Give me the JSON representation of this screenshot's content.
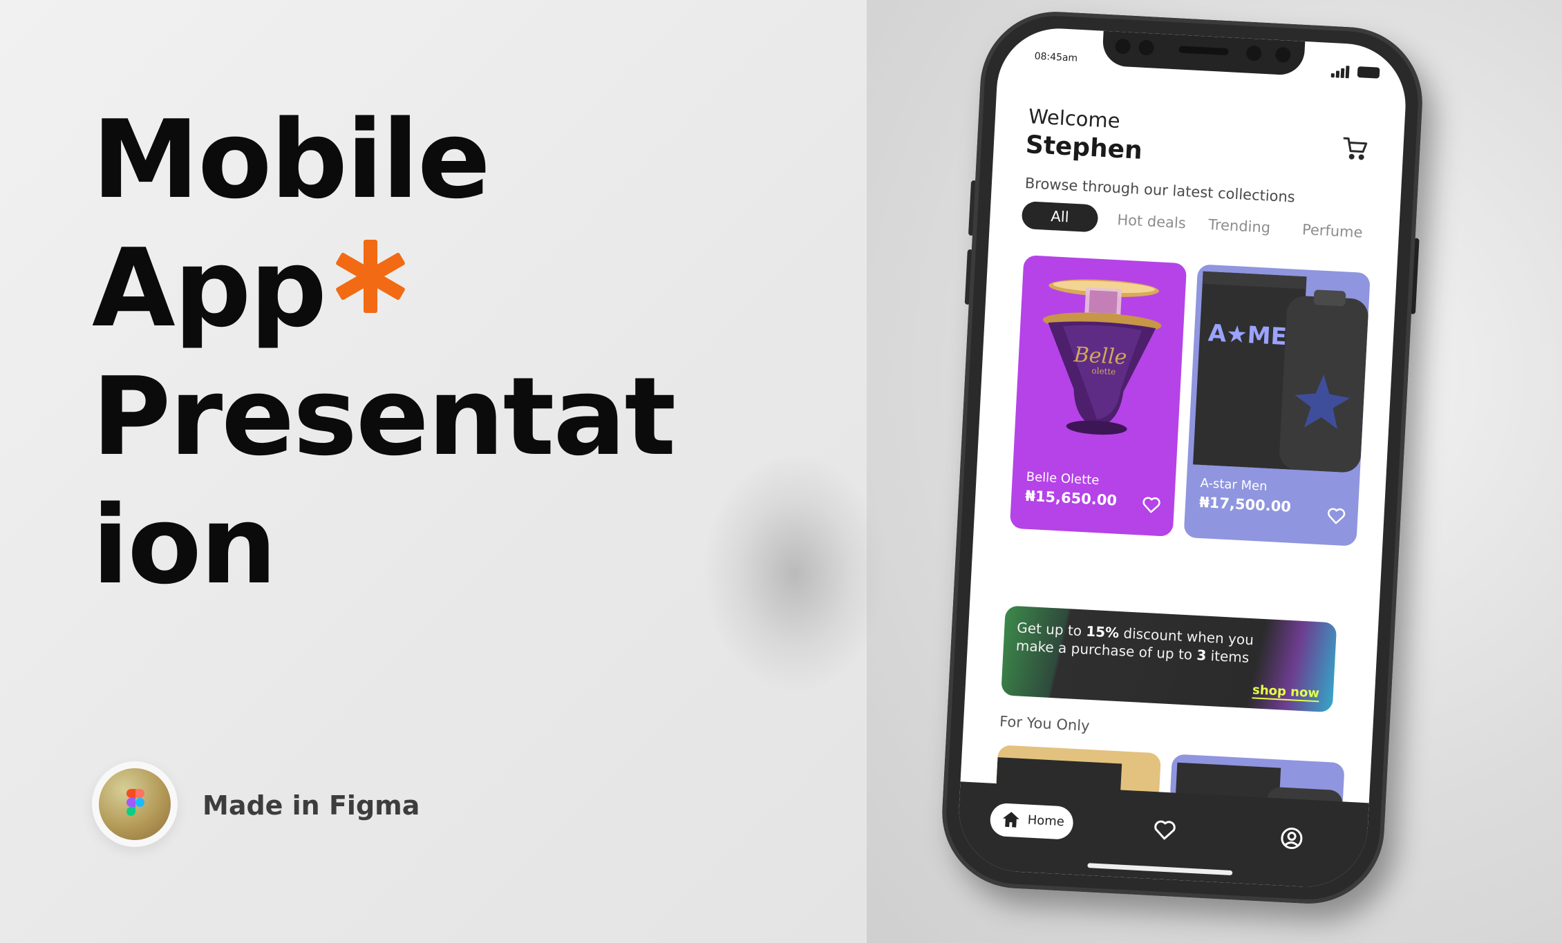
{
  "hero": {
    "title_line1": "Mobile",
    "title_line2": "App",
    "title_line3": "Presentat",
    "title_line4": "ion",
    "accent_color": "#f26a13",
    "accent_icon": "asterisk-icon"
  },
  "footer": {
    "badge_icon": "figma-logo-icon",
    "caption": "Made in Figma"
  },
  "phone": {
    "status": {
      "time": "08:45am"
    },
    "header": {
      "greeting": "Welcome",
      "username": "Stephen",
      "cart_icon": "cart-icon"
    },
    "subtitle": "Browse through our latest collections",
    "chips": [
      "All",
      "Hot deals",
      "Trending",
      "Perfume"
    ],
    "active_chip": "All",
    "products": [
      {
        "name": "Belle Olette",
        "price": "₦15,650.00",
        "bg_color": "#b543e8"
      },
      {
        "name": "A-star Men",
        "price": "₦17,500.00",
        "bg_color": "#8f95de"
      }
    ],
    "product_image_text": {
      "belle": "Belle",
      "belle_sub": "olette",
      "amen": "A★MEN"
    },
    "promo": {
      "text_part1": "Get up to ",
      "highlight1": "15%",
      "text_part2": " discount when you make a purchase of up to ",
      "highlight2": "3",
      "text_part3": " items",
      "cta": "shop now"
    },
    "section_title": "For You Only",
    "tabbar": {
      "home_label": "Home",
      "home_icon": "home-icon",
      "favorites_icon": "heart-icon",
      "profile_icon": "user-circle-icon"
    }
  }
}
